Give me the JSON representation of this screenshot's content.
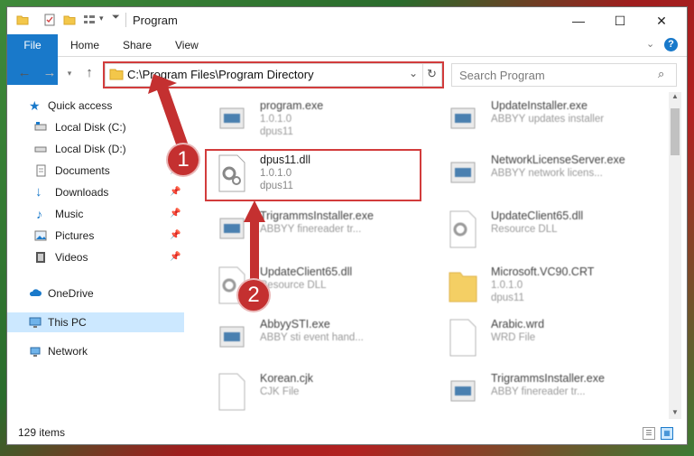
{
  "window": {
    "title": "Program"
  },
  "ribbon": {
    "tabs": [
      "File",
      "Home",
      "Share",
      "View"
    ]
  },
  "address": {
    "path": "C:\\Program Files\\Program Directory"
  },
  "search": {
    "placeholder": "Search Program"
  },
  "navpane": {
    "quick_access": "Quick access",
    "items": [
      {
        "label": "Local Disk (C:)",
        "icon": "drive-icon",
        "pinned": true
      },
      {
        "label": "Local Disk (D:)",
        "icon": "drive-icon",
        "pinned": false
      },
      {
        "label": "Documents",
        "icon": "documents-icon",
        "pinned": true
      },
      {
        "label": "Downloads",
        "icon": "download-icon",
        "pinned": true
      },
      {
        "label": "Music",
        "icon": "music-icon",
        "pinned": true
      },
      {
        "label": "Pictures",
        "icon": "pictures-icon",
        "pinned": true
      },
      {
        "label": "Videos",
        "icon": "videos-icon",
        "pinned": true
      }
    ],
    "onedrive": "OneDrive",
    "this_pc": "This PC",
    "network": "Network"
  },
  "files": [
    {
      "name": "program.exe",
      "line1": "1.0.1.0",
      "line2": "dpus11"
    },
    {
      "name": "UpdateInstaller.exe",
      "line1": "ABBYY updates installer",
      "line2": ""
    },
    {
      "name": "dpus11.dll",
      "line1": "1.0.1.0",
      "line2": "dpus11"
    },
    {
      "name": "NetworkLicenseServer.exe",
      "line1": "ABBYY network licens...",
      "line2": ""
    },
    {
      "name": "TrigrammsInstaller.exe",
      "line1": "ABBYY finereader tr...",
      "line2": ""
    },
    {
      "name": "UpdateClient65.dll",
      "line1": "Resource DLL",
      "line2": ""
    },
    {
      "name": "UpdateClient65.dll",
      "line1": "Resource DLL",
      "line2": ""
    },
    {
      "name": "Microsoft.VC90.CRT",
      "line1": "1.0.1.0",
      "line2": "dpus11"
    },
    {
      "name": "AbbyySTI.exe",
      "line1": "ABBY sti event hand...",
      "line2": ""
    },
    {
      "name": "Arabic.wrd",
      "line1": "WRD File",
      "line2": ""
    },
    {
      "name": "Korean.cjk",
      "line1": "CJK File",
      "line2": ""
    },
    {
      "name": "TrigrammsInstaller.exe",
      "line1": "ABBY finereader tr...",
      "line2": ""
    }
  ],
  "status": {
    "item_count": "129 items"
  },
  "callouts": [
    "1",
    "2"
  ],
  "colors": {
    "accent": "#1979ca",
    "highlight": "#d23c3c",
    "selection": "#cce8ff"
  }
}
